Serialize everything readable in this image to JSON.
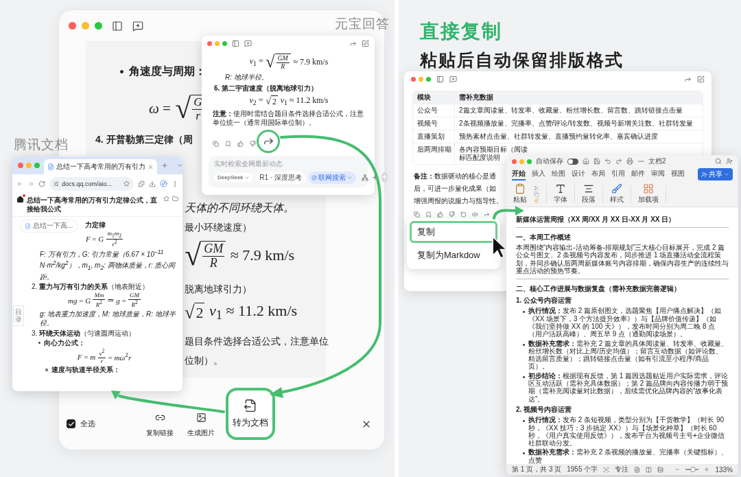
{
  "left": {
    "labels": {
      "answer": "元宝回答",
      "docs": "腾讯文档"
    },
    "main_window": {
      "upper_lines": [
        {
          "kind": "bullet",
          "text": "角速度与周期："
        },
        {
          "kind": "formula",
          "parts": [
            {
              "kind": "text",
              "text": "*ω* ="
            },
            {
              "kind": "radical",
              "text": "√"
            },
            {
              "kind": "overline_frac",
              "num": "*G*",
              "den": "*r*"
            }
          ]
        },
        {
          "kind": "heading",
          "text": "4. 开普勒第三定律（周"
        }
      ],
      "lower_lines": [
        {
          "kind": "italic",
          "text": "天体的不同环绕天体。"
        },
        {
          "kind": "text",
          "text": "最小环绕速度）"
        },
        {
          "kind": "formula",
          "parts": [
            {
              "kind": "radical",
              "text": "√"
            },
            {
              "kind": "overline_frac",
              "num": "*GM*",
              "den": "*R*"
            },
            {
              "kind": "text",
              "text": "≈ 7.9 km/s"
            }
          ]
        },
        {
          "kind": "text",
          "text": "脱离地球引力）"
        },
        {
          "kind": "formula",
          "parts": [
            {
              "kind": "radical",
              "text": "√"
            },
            {
              "kind": "overline",
              "text": "2"
            },
            {
              "kind": "text",
              "text": "*v*$_{1}$ ≈ 11.2 km/s"
            }
          ]
        },
        {
          "kind": "text",
          "text": "题目条件选择合适公式，注意单位"
        },
        {
          "kind": "text",
          "text": "位制）。"
        }
      ],
      "select_all": {
        "label": "全选",
        "checked": true
      },
      "actions": [
        {
          "kind": "link",
          "label": "复制链接",
          "selected": false
        },
        {
          "kind": "image",
          "label": "生成图片",
          "selected": false
        },
        {
          "kind": "document",
          "label": "转为文档",
          "selected": true
        }
      ]
    },
    "popup": {
      "lines": [
        {
          "kind": "formula",
          "parts": [
            {
              "kind": "text",
              "text": "*v*$_{1}$ ="
            },
            {
              "kind": "radical",
              "text": "√"
            },
            {
              "kind": "overline_frac",
              "num": "*GM*",
              "den": "*R*"
            },
            {
              "kind": "text",
              "text": "≈ 7.9 km/s"
            }
          ]
        },
        {
          "kind": "italic",
          "text": "R: 地球半径。"
        },
        {
          "kind": "heading",
          "text": "6. 第二宇宙速度（脱离地球引力）"
        },
        {
          "kind": "formula",
          "parts": [
            {
              "kind": "text",
              "text": "*v*$_{2}$ ="
            },
            {
              "kind": "radical",
              "text": "√"
            },
            {
              "kind": "overline",
              "text": "2"
            },
            {
              "kind": "text",
              "text": "*v*$_{1}$ ≈ 11.2 km/s"
            }
          ]
        },
        {
          "kind": "note",
          "text": "**注意：**使用时需结合题目条件选择合适公式，注意单位统一（通常用国际单位制）。"
        }
      ],
      "share_highlighted": true,
      "input": {
        "placeholder": "实时检索全网最新动态"
      },
      "chips": [
        {
          "label": "DeepSeek",
          "dropdown": true,
          "selected": false
        },
        {
          "label": "R1 · 深度思考",
          "dropdown": false,
          "selected": false
        },
        {
          "label": "联网搜索",
          "dropdown": true,
          "selected": true
        }
      ]
    },
    "browser": {
      "tab": {
        "title": "总结一下高考常用的万有引力"
      },
      "url": "docs.qq.com/aio...",
      "page_title": "总结一下高考常用的万有引力定律公式，直接给我公式",
      "doc_chip": "总结一下高...",
      "toc": "目录",
      "lines": [
        {
          "kind": "heading",
          "text": "力定律"
        },
        {
          "kind": "formula",
          "parts": [
            {
              "kind": "text",
              "text": "*F* = *G*"
            },
            {
              "kind": "frac",
              "num": "*m*$_{1}$*m*$_{2}$",
              "den": "*r*$^{2}$"
            }
          ]
        },
        {
          "kind": "italic",
          "text": "F: 万有引力，G: 引力常量（6.67 × 10$^{−11}$ N·m$^{2}$/kg$^{2}$），m$_{1}$, m$_{2}$: 两物体质量，r: 质心间距。"
        },
        {
          "kind": "numbered",
          "text": "2. **重力与万有引力的关系**（地表附近）"
        },
        {
          "kind": "formula",
          "parts": [
            {
              "kind": "text",
              "text": "*mg* = *G*"
            },
            {
              "kind": "frac",
              "num": "*Mm*",
              "den": "*R*$^{2}$"
            },
            {
              "kind": "text",
              "text": "⇒"
            },
            {
              "kind": "text",
              "text": "*g* ="
            },
            {
              "kind": "frac",
              "num": "*GM*",
              "den": "*R*$^{2}$"
            }
          ]
        },
        {
          "kind": "italic",
          "text": "g: 地表重力加速度，M: 地球质量，R: 地球半径。"
        },
        {
          "kind": "numbered",
          "text": "3. **环绕天体运动**（匀速圆周运动）"
        },
        {
          "kind": "bullet",
          "text": "向心力公式："
        },
        {
          "kind": "formula",
          "parts": [
            {
              "kind": "text",
              "text": "*F* = *m*"
            },
            {
              "kind": "frac",
              "num": "*v*$^{2}$",
              "den": "*r*"
            },
            {
              "kind": "text",
              "text": "= *mω*$^{2}$*r*"
            }
          ]
        },
        {
          "kind": "subbullet",
          "text": "速度与轨道半径关系："
        }
      ]
    }
  },
  "right": {
    "title": "直接复制",
    "subtitle": "粘贴后自动保留排版格式",
    "answer_window": {
      "columns": [
        "模块",
        "需补充数据"
      ],
      "rows": [
        {
          "module": "公众号",
          "data": [
            "2篇文章阅读量、转发率、收藏量、粉丝增长数、留言数、跳转链接点击量"
          ]
        },
        {
          "module": "视频号",
          "data": [
            "2条视频播放量、完播率、点赞/评论/转发数、视频号新增关注数、社群转发量"
          ]
        },
        {
          "module": "直播策划",
          "data": [
            "预热素材点击量、社群转发量、直播预约量转化率、嘉宾确认进度"
          ]
        },
        {
          "module": "后两周排期",
          "data": [
            "各内容预期目标（阅读",
            "标匹配度说明"
          ]
        }
      ],
      "note_lines": [
        "**备注：**数据驱动的核心是通",
        "后，可进一步量化成果（如",
        "增强周报的说服力与指导性。"
      ],
      "menu": [
        {
          "label": "复制",
          "selected": true
        },
        {
          "label": "复制为Markdow",
          "selected": false
        }
      ]
    },
    "word": {
      "autosave": {
        "label": "自动保存",
        "on": false
      },
      "doc_name": "文档2",
      "tabs": [
        {
          "label": "开始",
          "selected": true
        },
        {
          "label": "插入",
          "selected": false
        },
        {
          "label": "绘图",
          "selected": false
        },
        {
          "label": "设计",
          "selected": false
        },
        {
          "label": "布局",
          "selected": false
        },
        {
          "label": "引用",
          "selected": false
        },
        {
          "label": "邮件",
          "selected": false
        },
        {
          "label": "审阅",
          "selected": false
        },
        {
          "label": "视图",
          "selected": false
        }
      ],
      "share": "共享",
      "ribbon": [
        {
          "kind": "paste",
          "label": "粘贴"
        },
        {
          "kind": "font",
          "label": "字体"
        },
        {
          "kind": "paragraph",
          "label": "段落"
        },
        {
          "kind": "styles",
          "label": "样式"
        },
        {
          "kind": "addins",
          "label": "加载项"
        }
      ],
      "document": [
        {
          "kind": "title",
          "text": "新媒体运营周报（XX 周/XX 月 XX 日-XX 月 XX 日）"
        },
        {
          "kind": "rule"
        },
        {
          "kind": "heading",
          "text": "一、本周工作概述"
        },
        {
          "kind": "paragraph",
          "text": "本周围绕“内容输出-活动筹备-排期规划”三大核心目标展开，完成 2 篇公众号图文、2 条视频号内容发布，同步推进 1 场直播活动全流程策划，并同步确认后两周新媒体账号内容排期，确保内容生产的连续性与重点活动的预热节奏。"
        },
        {
          "kind": "rule"
        },
        {
          "kind": "heading",
          "text": "二、核心工作进展与数据复盘（需补充数据完善逻辑）"
        },
        {
          "kind": "subheading",
          "text": "1. 公众号内容运营"
        },
        {
          "kind": "bullet",
          "text": "**执行情况：**发布 2 篇原创图文，选题聚焦【用户痛点解决】（如《XX 场景下，3 个方法提升效率》）与【品牌价值传递】（如《我们坚持做 XX 的 100 天》），发布时间分别为周二晚 8 点（用户活跃高峰）、周五早 9 点（通勤阅读场景）。"
        },
        {
          "kind": "bullet",
          "text": "**数据补充需求：**需补充 2 篇文章的具体阅读量、转发率、收藏量、粉丝增长数（对比上周/历史均值）；留言互动数据（如评论数、精选留言质量）；跳转链接点击量（如有引流至小程序/商品页）。"
        },
        {
          "kind": "bullet",
          "text": "**初步结论：**根据现有反馈，第 1 篇因选题贴近用户实际需求，评论区互动活跃（需补充具体数据）；第 2 篇品牌向内容传播力弱于预期（需补充阅读量对比数据），后续需优化品牌内容的“故事化表达”。"
        },
        {
          "kind": "subheading",
          "text": "2. 视频号内容运营"
        },
        {
          "kind": "bullet",
          "text": "**执行情况：**发布 2 条短视频，类型分别为【干货教学】（时长 90 秒，《XX 技巧：3 步搞定 XX》）与【场景化种草】（时长 60 秒，《用户真实使用反馈》），发布平台为视频号主号+企业微信社群联动分发。"
        },
        {
          "kind": "bullet",
          "text": "**数据补充需求：**需补充 2 条视频的播放量、完播率（关键指标）、点赞"
        }
      ],
      "status": {
        "page": "第 1 页，共 3 页",
        "words": "1955 个字",
        "focus": "专注",
        "zoom": "133%",
        "level": 0.55
      }
    }
  }
}
